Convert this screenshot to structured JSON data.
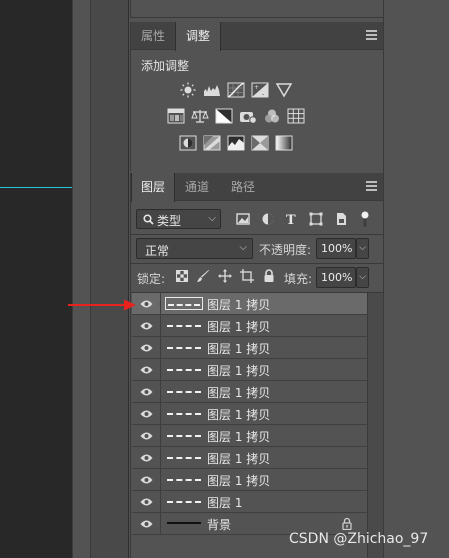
{
  "adjustments_panel": {
    "tabs": [
      {
        "label": "属性",
        "active": false
      },
      {
        "label": "调整",
        "active": true
      }
    ],
    "title": "添加调整",
    "icons_row1": [
      "brightness-icon",
      "levels-icon",
      "curves-icon",
      "exposure-icon",
      "vibrance-icon"
    ],
    "icons_row2": [
      "hue-saturation-icon",
      "color-balance-icon",
      "black-white-icon",
      "photo-filter-icon",
      "channel-mixer-icon",
      "color-lookup-icon"
    ],
    "icons_row3": [
      "invert-icon",
      "posterize-icon",
      "threshold-icon",
      "selective-color-icon",
      "gradient-map-icon"
    ]
  },
  "layers_panel": {
    "tabs": [
      {
        "label": "图层",
        "active": true
      },
      {
        "label": "通道",
        "active": false
      },
      {
        "label": "路径",
        "active": false
      }
    ],
    "filter_label": "类型",
    "blend_mode": "正常",
    "opacity_label": "不透明度:",
    "opacity_value": "100%",
    "lock_label": "锁定:",
    "fill_label": "填充:",
    "fill_value": "100%",
    "layers": [
      {
        "name": "图层 1 拷贝",
        "visible": true,
        "selected": true
      },
      {
        "name": "图层 1 拷贝",
        "visible": true,
        "selected": false
      },
      {
        "name": "图层 1 拷贝",
        "visible": true,
        "selected": false
      },
      {
        "name": "图层 1 拷贝",
        "visible": true,
        "selected": false
      },
      {
        "name": "图层 1 拷贝",
        "visible": true,
        "selected": false
      },
      {
        "name": "图层 1 拷贝",
        "visible": true,
        "selected": false
      },
      {
        "name": "图层 1 拷贝",
        "visible": true,
        "selected": false
      },
      {
        "name": "图层 1 拷贝",
        "visible": true,
        "selected": false
      },
      {
        "name": "图层 1 拷贝",
        "visible": true,
        "selected": false
      },
      {
        "name": "图层 1",
        "visible": true,
        "selected": false
      },
      {
        "name": "背景",
        "visible": true,
        "selected": false,
        "locked": true
      }
    ]
  },
  "annotation": {
    "arrow_color": "#e8231e"
  },
  "watermark": "CSDN @Zhichao_97",
  "colors": {
    "guide": "#25c5dc",
    "panel_bg": "#535353",
    "selected_row": "#6a6a6a"
  }
}
